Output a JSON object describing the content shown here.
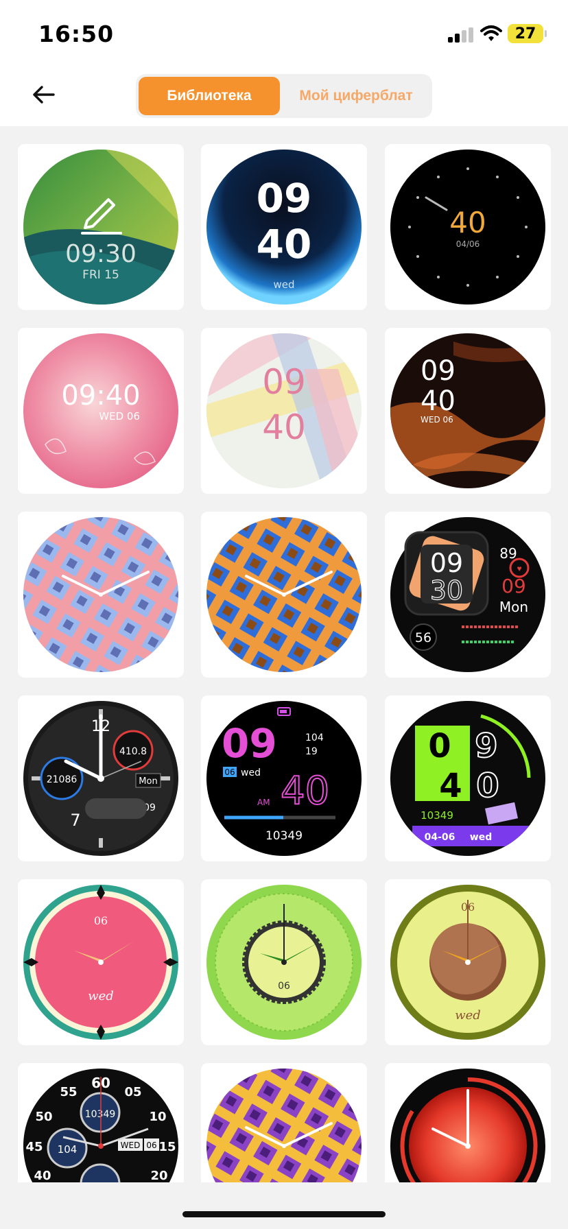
{
  "status_bar": {
    "time": "16:50",
    "battery": "27"
  },
  "nav": {
    "back_icon": "arrow-left-icon"
  },
  "tabs": [
    {
      "label": "Библиотека",
      "active": true
    },
    {
      "label": "Мой циферблат",
      "active": false
    }
  ],
  "colors": {
    "accent": "#f5922e",
    "accent_light": "#f5a867"
  },
  "faces": [
    {
      "name": "green-edit",
      "lines": [
        "09:30",
        "FRI 15"
      ]
    },
    {
      "name": "blue-digital",
      "lines": [
        "09",
        "40",
        "wed"
      ]
    },
    {
      "name": "black-minimal",
      "lines": [
        "40",
        "04/06"
      ]
    },
    {
      "name": "pink-watercolor",
      "lines": [
        "09:40",
        "WED 06"
      ]
    },
    {
      "name": "pastel-stripes",
      "lines": [
        "09",
        "40"
      ]
    },
    {
      "name": "copper-marble",
      "lines": [
        "09",
        "40",
        "WED 06"
      ]
    },
    {
      "name": "pink-blue-weave",
      "lines": []
    },
    {
      "name": "orange-blue-weave",
      "lines": []
    },
    {
      "name": "black-sport",
      "lines": [
        "09",
        "30",
        "89",
        "09",
        "Mon",
        "56"
      ]
    },
    {
      "name": "black-analog-sport",
      "lines": [
        "12",
        "410.8",
        "21086",
        "Mon",
        "09",
        "7"
      ]
    },
    {
      "name": "neon-digital",
      "lines": [
        "09",
        "104",
        "19",
        "06",
        "wed",
        "AM",
        "40",
        "10349"
      ]
    },
    {
      "name": "green-street",
      "lines": [
        "0",
        "9",
        "4",
        "0",
        "10349",
        "04-06",
        "wed"
      ]
    },
    {
      "name": "pink-teal",
      "lines": [
        "06",
        "wed"
      ]
    },
    {
      "name": "lime-gear",
      "lines": [
        "06"
      ]
    },
    {
      "name": "olive-brown",
      "lines": [
        "06",
        "wed"
      ]
    },
    {
      "name": "black-chrono",
      "lines": [
        "60",
        "55",
        "05",
        "50",
        "10",
        "45",
        "15",
        "40",
        "20",
        "10349",
        "104",
        "WED",
        "06"
      ]
    },
    {
      "name": "purple-yellow-weave",
      "lines": []
    },
    {
      "name": "red-sport",
      "lines": []
    }
  ]
}
